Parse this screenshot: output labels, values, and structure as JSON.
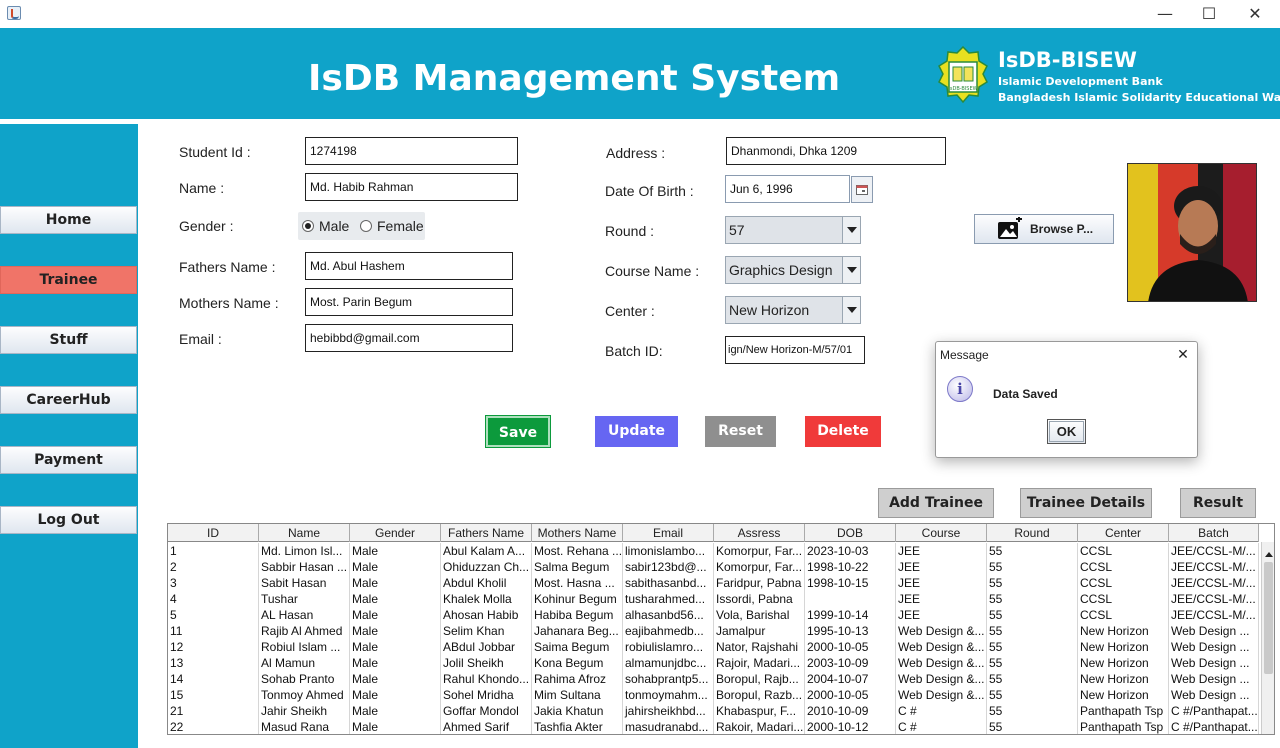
{
  "window": {
    "minimize_glyph": "—",
    "maximize_glyph": "☐",
    "close_glyph": "✕"
  },
  "header": {
    "title": "IsDB Management System",
    "org_name": "IsDB-BISEW",
    "org_line1": "Islamic Development Bank",
    "org_line2": "Bangladesh Islamic Solidarity Educational Wakf",
    "logo_text": "IsDB-BISEW"
  },
  "sidebar": {
    "items": [
      {
        "label": "Home"
      },
      {
        "label": "Trainee"
      },
      {
        "label": "Stuff"
      },
      {
        "label": "CareerHub"
      },
      {
        "label": "Payment"
      },
      {
        "label": "Log Out"
      }
    ],
    "active": "Trainee"
  },
  "form": {
    "student_id": {
      "label": "Student Id :",
      "value": "1274198"
    },
    "name": {
      "label": "Name :",
      "value": "Md. Habib Rahman"
    },
    "gender": {
      "label": "Gender :",
      "options": [
        "Male",
        "Female"
      ],
      "selected": "Male"
    },
    "fathers_name": {
      "label": "Fathers Name :",
      "value": "Md. Abul Hashem"
    },
    "mothers_name": {
      "label": "Mothers Name :",
      "value": "Most. Parin Begum"
    },
    "email": {
      "label": "Email :",
      "value": "hebibbd@gmail.com"
    },
    "address": {
      "label": "Address :",
      "value": "Dhanmondi, Dhka 1209"
    },
    "dob": {
      "label": "Date Of Birth :",
      "value": "Jun 6, 1996"
    },
    "round": {
      "label": "Round :",
      "value": "57"
    },
    "course": {
      "label": "Course Name :",
      "value": "Graphics Design"
    },
    "center": {
      "label": "Center :",
      "value": "New Horizon"
    },
    "batch": {
      "label": "Batch ID:",
      "value": "ign/New Horizon-M/57/01"
    },
    "browse_label": "Browse P..."
  },
  "actions": {
    "save": "Save",
    "update": "Update",
    "reset": "Reset",
    "delete": "Delete"
  },
  "table_actions": {
    "add": "Add Trainee",
    "details": "Trainee Details",
    "result": "Result"
  },
  "colors": {
    "header_bg": "#0fa3c9",
    "active_nav": "#f07468",
    "save": "#0c9a3c",
    "update": "#6666f2",
    "reset": "#8f8f8f",
    "delete": "#f03a3a"
  },
  "table": {
    "columns": [
      "ID",
      "Name",
      "Gender",
      "Fathers Name",
      "Mothers Name",
      "Email",
      "Assress",
      "DOB",
      "Course",
      "Round",
      "Center",
      "Batch"
    ],
    "rows": [
      [
        "1",
        "Md. Limon Isl...",
        "Male",
        "Abul Kalam A...",
        "Most. Rehana ...",
        "limonislambo...",
        "Komorpur, Far...",
        "2023-10-03",
        "JEE",
        "55",
        "CCSL",
        "JEE/CCSL-M/..."
      ],
      [
        "2",
        "Sabbir Hasan ...",
        "Male",
        "Ohiduzzan Ch...",
        "Salma Begum",
        "sabir123bd@...",
        "Komorpur, Far...",
        "1998-10-22",
        "JEE",
        "55",
        "CCSL",
        "JEE/CCSL-M/..."
      ],
      [
        "3",
        "Sabit Hasan",
        "Male",
        "Abdul Kholil",
        "Most. Hasna ...",
        "sabithasanbd...",
        "Faridpur, Pabna",
        "1998-10-15",
        "JEE",
        "55",
        "CCSL",
        "JEE/CCSL-M/..."
      ],
      [
        "4",
        "Tushar",
        "Male",
        "Khalek Molla",
        "Kohinur Begum",
        "tusharahmed...",
        "Issordi, Pabna",
        "",
        "JEE",
        "55",
        "CCSL",
        "JEE/CCSL-M/..."
      ],
      [
        "5",
        "AL Hasan",
        "Male",
        "Ahosan Habib",
        "Habiba Begum",
        "alhasanbd56...",
        "Vola, Barishal",
        "1999-10-14",
        "JEE",
        "55",
        "CCSL",
        "JEE/CCSL-M/..."
      ],
      [
        "11",
        "Rajib Al Ahmed",
        "Male",
        "Selim Khan",
        "Jahanara Beg...",
        "eajibahmedb...",
        "Jamalpur",
        "1995-10-13",
        "Web Design &...",
        "55",
        "New Horizon",
        "Web Design ..."
      ],
      [
        "12",
        "Robiul Islam ...",
        "Male",
        "ABdul Jobbar",
        "Saima Begum",
        "robiulislamro...",
        "Nator, Rajshahi",
        "2000-10-05",
        "Web Design &...",
        "55",
        "New Horizon",
        "Web Design ..."
      ],
      [
        "13",
        "Al Mamun",
        "Male",
        "Jolil Sheikh",
        "Kona Begum",
        "almamunjdbc...",
        "Rajoir, Madari...",
        "2003-10-09",
        "Web Design &...",
        "55",
        "New Horizon",
        "Web Design ..."
      ],
      [
        "14",
        "Sohab Pranto",
        "Male",
        "Rahul Khondo...",
        "Rahima Afroz",
        "sohabprantp5...",
        "Boropul, Rajb...",
        "2004-10-07",
        "Web Design &...",
        "55",
        "New Horizon",
        "Web Design ..."
      ],
      [
        "15",
        "Tonmoy Ahmed",
        "Male",
        "Sohel Mridha",
        "Mim Sultana",
        "tonmoymahm...",
        "Boropul, Razb...",
        "2000-10-05",
        "Web Design &...",
        "55",
        "New Horizon",
        "Web Design ..."
      ],
      [
        "21",
        "Jahir Sheikh",
        "Male",
        "Goffar Mondol",
        "Jakia Khatun",
        "jahirsheikhbd...",
        "Khabaspur, F...",
        "2010-10-09",
        "C #",
        "55",
        "Panthapath Tsp",
        "C #/Panthapat..."
      ],
      [
        "22",
        "Masud Rana",
        "Male",
        "Ahmed Sarif",
        "Tashfia Akter",
        "masudranabd...",
        "Rakoir, Madari...",
        "2000-10-12",
        "C #",
        "55",
        "Panthapath Tsp",
        "C #/Panthapat..."
      ]
    ]
  },
  "dialog": {
    "title": "Message",
    "message": "Data Saved",
    "ok": "OK",
    "info_glyph": "i",
    "close_glyph": "✕"
  }
}
